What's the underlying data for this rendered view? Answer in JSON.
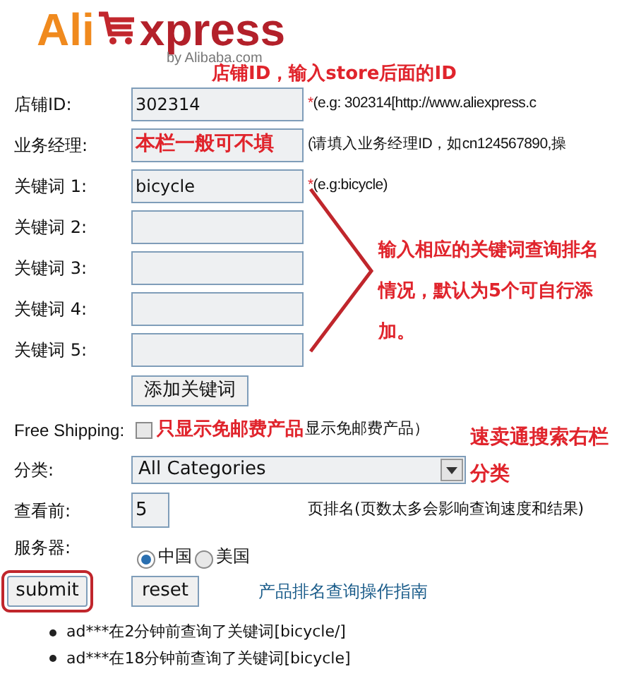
{
  "logo": {
    "brand_start": "Ali",
    "brand_end": "xpress",
    "tagline": "by Alibaba.com"
  },
  "store_id": {
    "label": "店铺ID:",
    "value": "302314",
    "required_mark": "*",
    "hint": "(e.g: 302314[http://www.aliexpress.c"
  },
  "manager": {
    "label": "业务经理:",
    "value": "本栏一般可不填",
    "hint": "(请填入业务经理ID，如cn124567890,操"
  },
  "keywords": [
    {
      "label": "关键词 1:",
      "value": "bicycle",
      "required_mark": "*",
      "hint": "(e.g:bicycle)"
    },
    {
      "label": "关键词 2:"
    },
    {
      "label": "关键词 3:"
    },
    {
      "label": "关键词 4:"
    },
    {
      "label": "关键词 5:"
    }
  ],
  "add_keyword_button": "添加关键词",
  "free_shipping": {
    "label": "Free Shipping:",
    "checked": false,
    "text": "显示免邮费产品）"
  },
  "category": {
    "label": "分类:",
    "value": "All Categories"
  },
  "pages": {
    "label": "查看前:",
    "value": "5",
    "suffix": "页排名(页数太多会影响查询速度和结果)"
  },
  "server": {
    "label": "服务器:",
    "options": [
      {
        "label": "中国",
        "selected": true
      },
      {
        "label": "美国",
        "selected": false
      }
    ]
  },
  "buttons": {
    "submit": "submit",
    "reset": "reset"
  },
  "guide_link": "产品排名查询操作指南",
  "recent_queries": [
    "ad***在2分钟前查询了关键词[bicycle/]",
    "ad***在18分钟前查询了关键词[bicycle]"
  ],
  "annotations": {
    "store_id": "店铺ID，输入store后面的ID",
    "keywords": "输入相应的关键词查询排名情况，默认为5个可自行添加。",
    "free_shipping": "只显示免邮费产品",
    "category": "速卖通搜索右栏分类"
  }
}
